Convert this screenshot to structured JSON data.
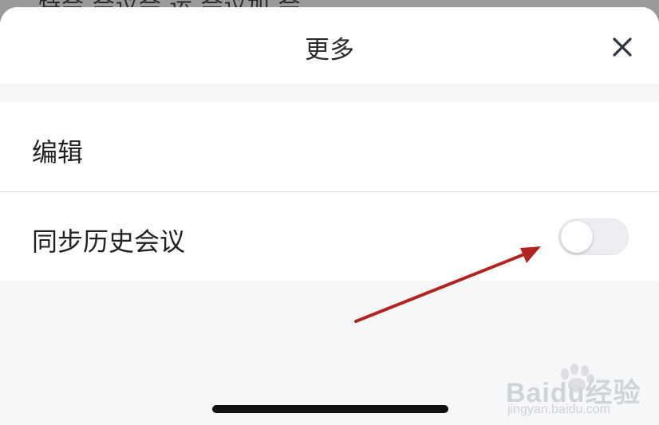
{
  "background": {
    "partial_text": "特会 会议会 运 会议加 会"
  },
  "sheet": {
    "title": "更多",
    "close_icon": "close-icon",
    "items": [
      {
        "label": "编辑"
      },
      {
        "label": "同步历史会议",
        "toggle": {
          "on": false
        }
      }
    ]
  },
  "watermark": {
    "logo": "Baidu经验",
    "sub": "jingyan.baidu.com"
  },
  "colors": {
    "sheet_bg": "#f6f7f9",
    "row_bg": "#ffffff",
    "toggle_off": "#eceef1",
    "arrow": "#b0261f"
  }
}
